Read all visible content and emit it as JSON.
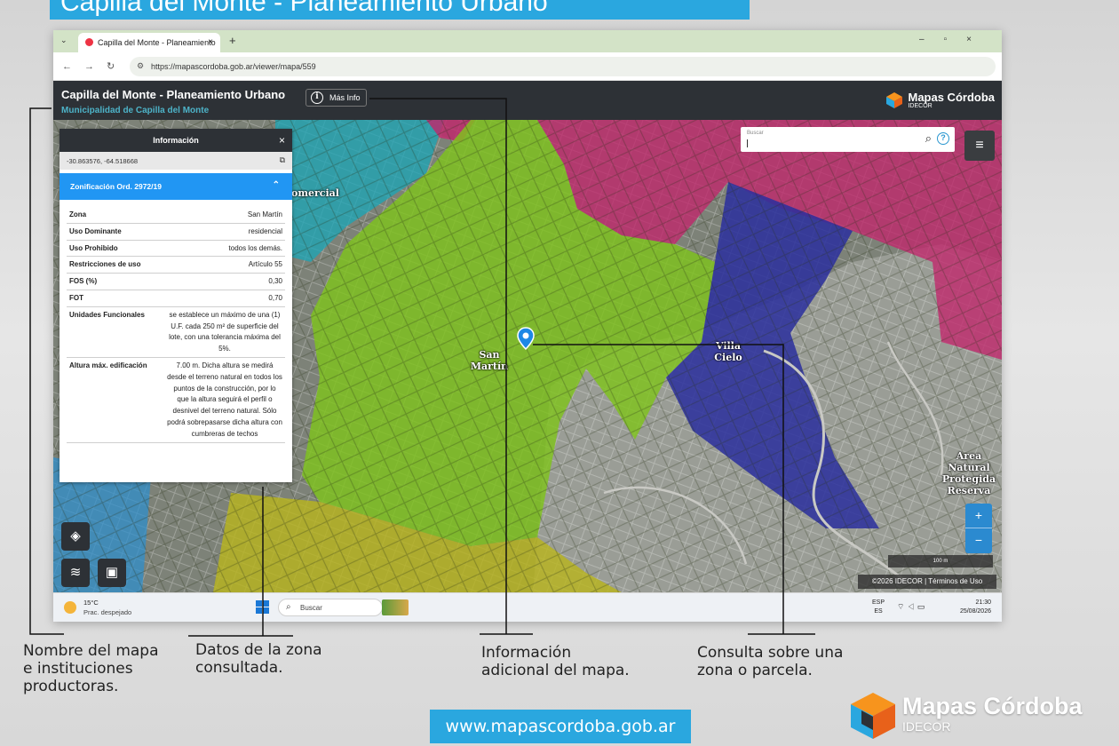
{
  "banner": {
    "title": "Capilla del Monte - Planeamiento Urbano"
  },
  "browser": {
    "tab_title": "Capilla del Monte - Planeamiento",
    "url": "https://mapascordoba.gob.ar/viewer/mapa/559"
  },
  "app": {
    "title": "Capilla del Monte - Planeamiento Urbano",
    "subtitle": "Municipalidad de Capilla del Monte",
    "more_info_label": "Más Info",
    "brand": "Mapas Córdoba",
    "brand_sub": "IDECOR"
  },
  "search": {
    "label": "Buscar"
  },
  "info_panel": {
    "title": "Información",
    "coordinates": "-30.863576, -64.518668",
    "section_title": "Zonificación Ord. 2972/19",
    "rows": [
      {
        "key": "Zona",
        "value": "San Martín"
      },
      {
        "key": "Uso Dominante",
        "value": "residencial"
      },
      {
        "key": "Uso Prohibido",
        "value": "todos los demás."
      },
      {
        "key": "Restricciones de uso",
        "value": "Artículo 55"
      },
      {
        "key": "FOS (%)",
        "value": "0,30"
      },
      {
        "key": "FOT",
        "value": "0,70"
      },
      {
        "key": "Unidades Funcionales",
        "value": "se establece un máximo de una (1) U.F. cada 250 m² de superficie del lote, con una tolerancia máxima del 5%."
      },
      {
        "key": "Altura máx. edificación",
        "value": "7.00 m. Dicha altura se medirá desde el terreno natural en todos los puntos de la construcción, por lo que la altura seguirá el perfil o desnivel del terreno natural. Sólo podrá sobrepasarse dicha altura con cumbreras de techos"
      }
    ]
  },
  "map_labels": {
    "comercial": "omercial",
    "san_martin": "San Martín",
    "villa_cielo": "Villa Cielo",
    "reserva": "Area Natural Protegida Reserva"
  },
  "map_controls": {
    "scale": "100 m",
    "attribution": "©2026 IDECOR | Términos de Uso"
  },
  "taskbar": {
    "temp": "15°C",
    "weather": "Prac. despejado",
    "search": "Buscar",
    "lang1": "ESP",
    "lang2": "ES",
    "time": "21:30",
    "date": "25/08/2026"
  },
  "annotations": {
    "name": "Nombre del mapa\ne instituciones\nproductoras.",
    "zone_data": "Datos de la zona\nconsultada.",
    "extra_info": "Información\nadicional del mapa.",
    "query": "Consulta sobre una\nzona o parcela."
  },
  "footer": {
    "url": "www.mapascordoba.gob.ar",
    "brand": "Mapas Córdoba",
    "brand_sub": "IDECOR"
  },
  "colors": {
    "accent": "#2aa7df",
    "zone_green": "#7fc31c",
    "zone_blue": "#2a2f9e",
    "zone_magenta": "#c2266b",
    "zone_cyan": "#1aa6b7",
    "zone_olive": "#b9b51c",
    "header_bg": "#2d3136"
  }
}
